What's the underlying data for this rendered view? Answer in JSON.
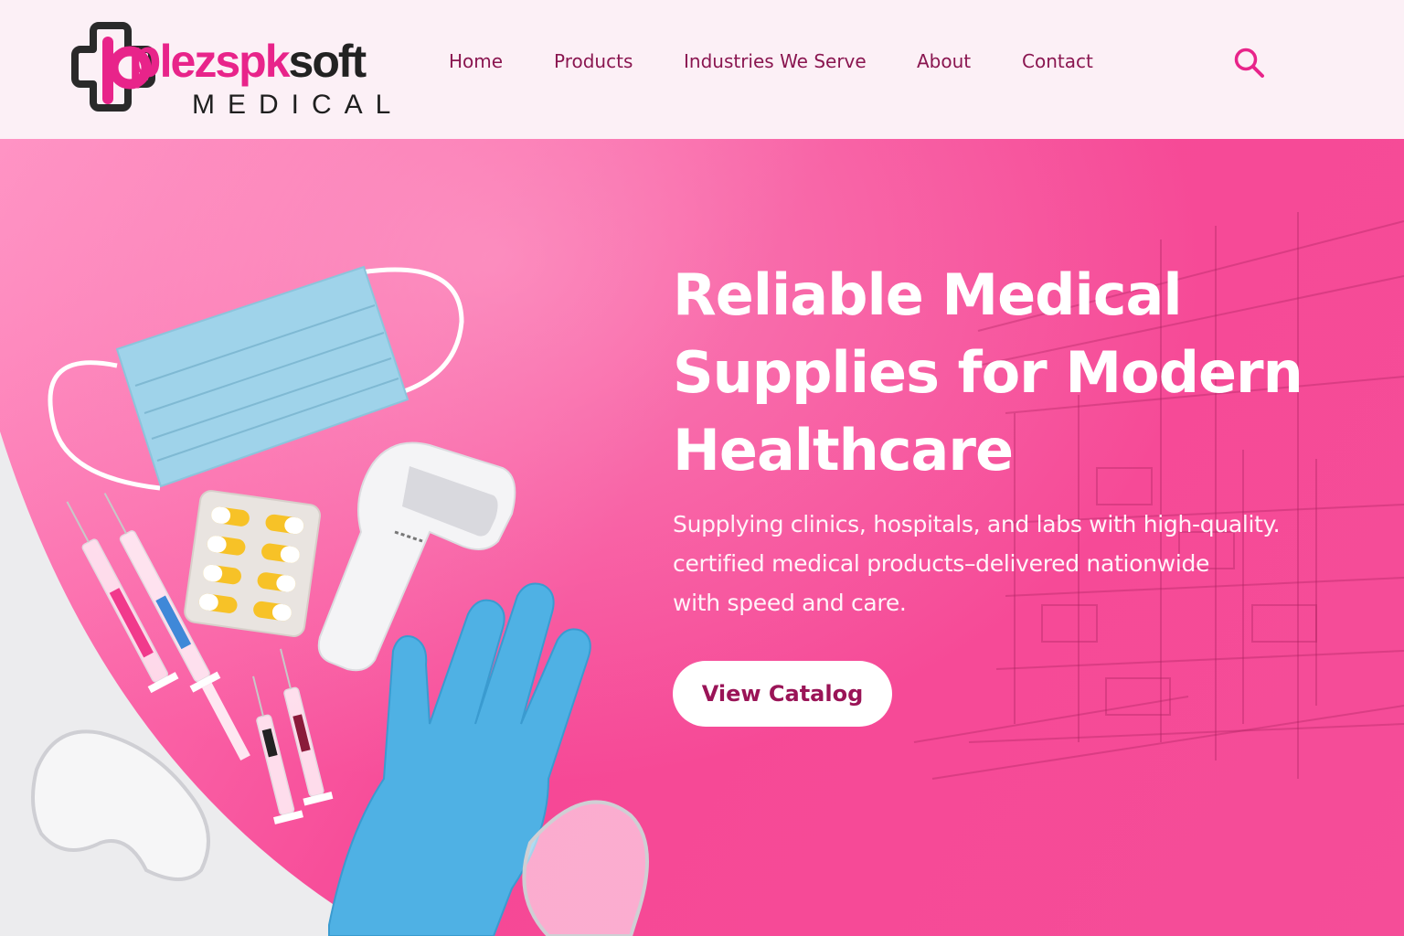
{
  "brand": {
    "name_first_letter": "p",
    "name_rest": "lezspk",
    "name_end": "soft",
    "subtitle": "MEDICAL"
  },
  "nav": {
    "items": [
      {
        "label": "Home"
      },
      {
        "label": "Products"
      },
      {
        "label": "Industries We Serve"
      },
      {
        "label": "About"
      },
      {
        "label": "Contact"
      }
    ],
    "search_icon": "search-icon"
  },
  "hero": {
    "title_lines": [
      "Reliable Medical",
      "Supplies for Modern",
      "Healthcare"
    ],
    "subtitle_lines": [
      "Supplying clinics, hospitals, and labs with high-quality.",
      "certified medical products–delivered nationwide",
      "with speed and care."
    ],
    "cta_label": "View Catalog"
  },
  "colors": {
    "brand_pink": "#e8248a",
    "nav_text": "#8a1650",
    "header_bg": "#fcf0f6",
    "hero_pink": "#f54d98",
    "cta_text": "#9a1457"
  }
}
